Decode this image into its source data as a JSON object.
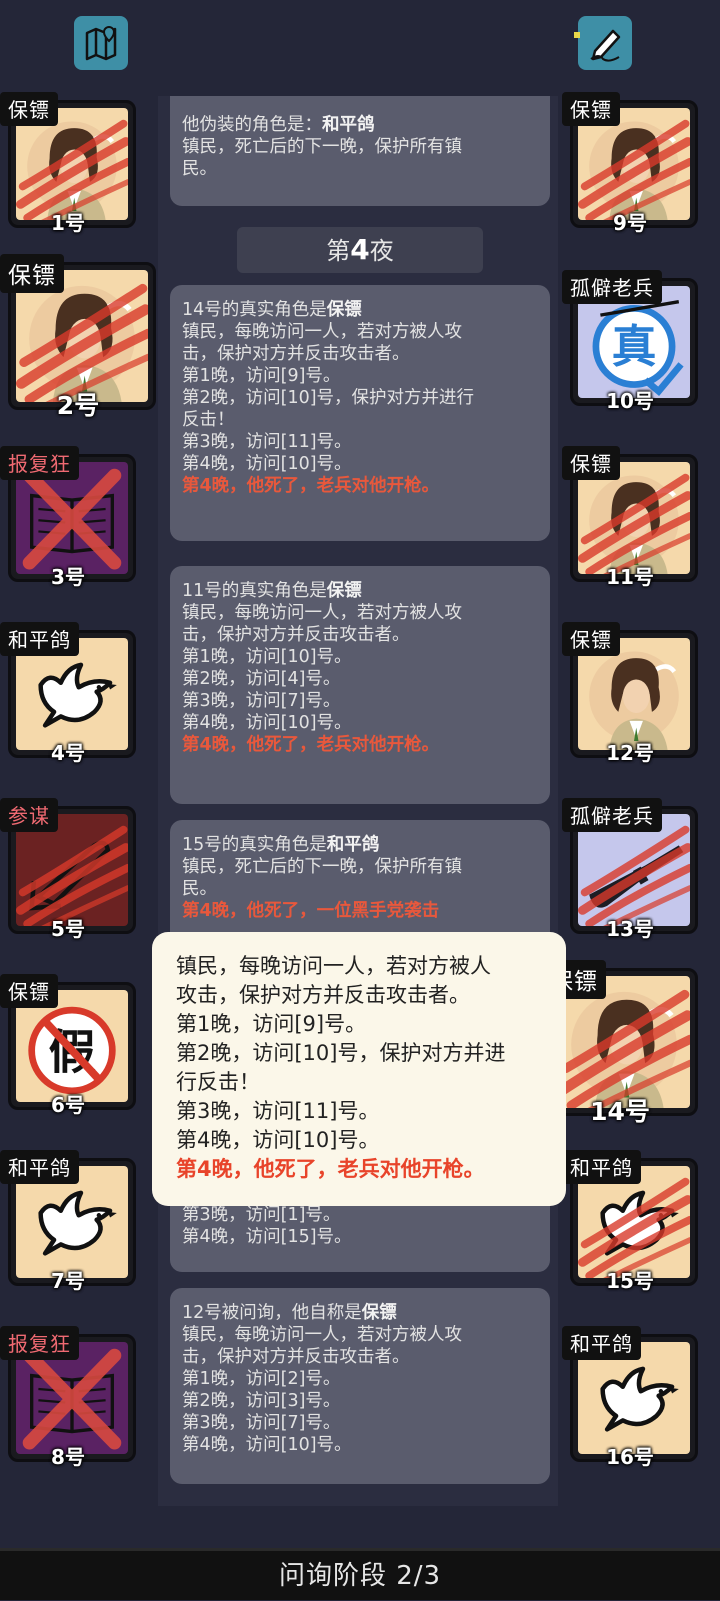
{
  "phase_label": "问询阶段 2/3",
  "night_header": {
    "prefix": "第",
    "number": "4",
    "suffix": "夜"
  },
  "top_icons": {
    "left": "map-icon",
    "right": "note-edit-icon"
  },
  "colors": {
    "background": "#242638",
    "message_bg": "#5a5c6d",
    "death_text": "#e8583c",
    "tooltip_bg": "#fbf7e9"
  },
  "left_players": [
    {
      "role": "保镖",
      "number": "1号",
      "art": "bodyguard-portrait",
      "dead": true
    },
    {
      "role": "保镖",
      "number": "2号",
      "art": "bodyguard-portrait",
      "dead": true
    },
    {
      "role": "报复狂",
      "number": "3号",
      "art": "book-icon",
      "dead": true
    },
    {
      "role": "和平鸽",
      "number": "4号",
      "art": "dove-icon",
      "dead": false
    },
    {
      "role": "参谋",
      "number": "5号",
      "art": "quill-icon",
      "dead": true
    },
    {
      "role": "保镖",
      "number": "6号",
      "art": "fake-stamp-icon",
      "dead": false
    },
    {
      "role": "和平鸽",
      "number": "7号",
      "art": "dove-icon",
      "dead": false
    },
    {
      "role": "报复狂",
      "number": "8号",
      "art": "book-icon",
      "dead": true
    }
  ],
  "right_players": [
    {
      "role": "保镖",
      "number": "9号",
      "art": "bodyguard-portrait",
      "dead": true
    },
    {
      "role": "孤僻老兵",
      "number": "10号",
      "art": "true-stamp-icon",
      "dead": false
    },
    {
      "role": "保镖",
      "number": "11号",
      "art": "bodyguard-portrait",
      "dead": true
    },
    {
      "role": "保镖",
      "number": "12号",
      "art": "bodyguard-portrait",
      "dead": false
    },
    {
      "role": "孤僻老兵",
      "number": "13号",
      "art": "rifle-icon",
      "dead": true
    },
    {
      "role": "保镖",
      "number": "14号",
      "art": "bodyguard-portrait",
      "dead": true
    },
    {
      "role": "和平鸽",
      "number": "15号",
      "art": "dove-icon",
      "dead": true
    },
    {
      "role": "和平鸽",
      "number": "16号",
      "art": "dove-icon",
      "dead": false
    }
  ],
  "messages": {
    "m0": {
      "l1_prefix": "他伪装的角色是：",
      "l1_bold": "和平鸽",
      "l2": "镇民，死亡后的下一晚，保护所有镇",
      "l3": "民。"
    },
    "m1": {
      "l1_prefix": "14号的真实角色是",
      "l1_bold": "保镖",
      "lines": [
        "镇民，每晚访问一人，若对方被人攻",
        "击，保护对方并反击攻击者。",
        "第1晚，访问[9]号。",
        "第2晚，访问[10]号，保护对方并进行",
        "反击！",
        "第3晚，访问[11]号。",
        "第4晚，访问[10]号。"
      ],
      "death": "第4晚，他死了，老兵对他开枪。"
    },
    "m2": {
      "l1_prefix": "11号的真实角色是",
      "l1_bold": "保镖",
      "lines": [
        "镇民，每晚访问一人，若对方被人攻",
        "击，保护对方并反击攻击者。",
        "第1晚，访问[10]号。",
        "第2晚，访问[4]号。",
        "第3晚，访问[7]号。",
        "第4晚，访问[10]号。"
      ],
      "death": "第4晚，他死了，老兵对他开枪。"
    },
    "m3": {
      "l1_prefix": "15号的真实角色是",
      "l1_bold": "和平鸽",
      "lines": [
        "镇民，死亡后的下一晚，保护所有镇",
        "民。"
      ],
      "death": "第4晚，他死了，一位黑手党袭击"
    },
    "m4": {
      "lines": [
        "第3晚，访问[1]号。",
        "第4晚，访问[15]号。"
      ]
    },
    "m5": {
      "l1_prefix": "12号被问询，他自称是",
      "l1_bold": "保镖",
      "lines": [
        "镇民，每晚访问一人，若对方被人攻",
        "击，保护对方并反击攻击者。",
        "第1晚，访问[2]号。",
        "第2晚，访问[3]号。",
        "第3晚，访问[7]号。",
        "第4晚，访问[10]号。"
      ]
    }
  },
  "tooltip": {
    "lines": [
      "镇民，每晚访问一人，若对方被人",
      "攻击，保护对方并反击攻击者。",
      "第1晚，访问[9]号。",
      "第2晚，访问[10]号，保护对方并进",
      "行反击！",
      "第3晚，访问[11]号。",
      "第4晚，访问[10]号。"
    ],
    "death": "第4晚，他死了，老兵对他开枪。"
  }
}
